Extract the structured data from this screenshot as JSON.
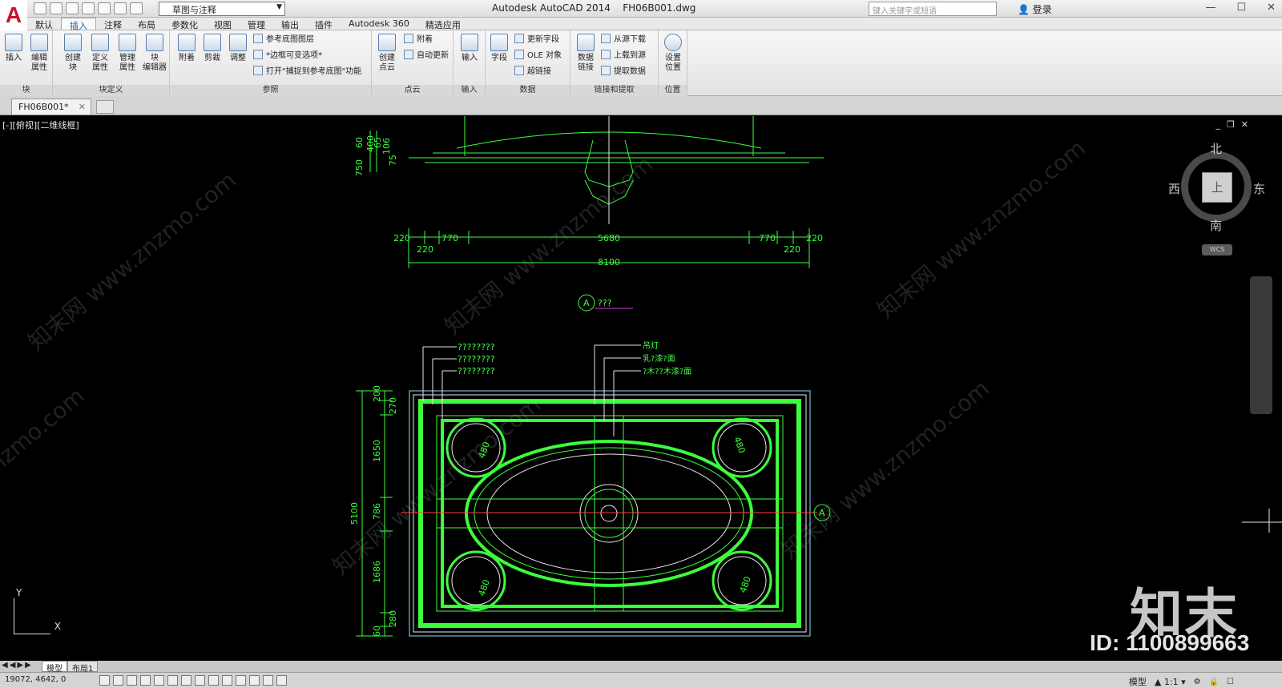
{
  "app": {
    "logo_glyph": "A",
    "title": "Autodesk AutoCAD 2014",
    "document": "FH06B001.dwg",
    "workspace": "草图与注释",
    "search_placeholder": "键入关键字或短语",
    "login": "登录"
  },
  "ribbon_tabs": [
    "默认",
    "插入",
    "注释",
    "布局",
    "参数化",
    "视图",
    "管理",
    "输出",
    "插件",
    "Autodesk 360",
    "精选应用"
  ],
  "active_tab": "插入",
  "panels": {
    "block": {
      "title": "块",
      "buttons": [
        {
          "label": "插入"
        },
        {
          "label": "编辑\n属性"
        }
      ]
    },
    "block_def": {
      "title": "块定义",
      "buttons": [
        {
          "label": "创建\n块"
        },
        {
          "label": "定义\n属性"
        },
        {
          "label": "管理\n属性"
        },
        {
          "label": "块\n编辑器"
        }
      ]
    },
    "reference": {
      "title": "参照",
      "buttons": [
        {
          "label": "附着"
        },
        {
          "label": "剪裁"
        },
        {
          "label": "调整"
        }
      ],
      "small": [
        "参考底图图层",
        "*边框可变选项*",
        "打开\"捕捉到参考底图\"功能"
      ]
    },
    "pointcloud": {
      "title": "点云",
      "buttons": [
        {
          "label": "创建\n点云"
        }
      ],
      "small": [
        "附着",
        "自动更新"
      ]
    },
    "import": {
      "title": "输入",
      "buttons": [
        {
          "label": "输入"
        }
      ]
    },
    "data": {
      "title": "数据",
      "buttons": [
        {
          "label": "字段"
        }
      ],
      "small": [
        "更新字段",
        "OLE 对象",
        "超链接"
      ]
    },
    "linking": {
      "title": "链接和提取",
      "buttons": [
        {
          "label": "数据\n链接"
        }
      ],
      "small": [
        "从源下载",
        "上载到源",
        "提取数据"
      ]
    },
    "location": {
      "title": "位置",
      "buttons": [
        {
          "label": "设置\n位置"
        }
      ]
    }
  },
  "document_tab": "FH06B001*",
  "viewport": {
    "label": "[-][俯视][二维线框]",
    "ctrl_min": "_",
    "ctrl_restore": "❐",
    "ctrl_close": "✕"
  },
  "viewcube": {
    "north": "北",
    "south": "南",
    "east": "东",
    "west": "西",
    "face": "上",
    "wcs": "WCS"
  },
  "drawing": {
    "top_dims_left": [
      "750",
      "400",
      "60",
      "65",
      "106",
      "75"
    ],
    "dim_row1": [
      "220",
      "770",
      "5680",
      "770",
      "220"
    ],
    "dim_row2": [
      "220",
      "220"
    ],
    "dim_total": "8100",
    "section_marker": "A",
    "section_label": "???",
    "left_callouts": [
      "????????",
      "????????",
      "????????"
    ],
    "right_callouts": [
      "吊灯",
      "乳?漆?面",
      "?木??木漆?面"
    ],
    "side_dims": [
      "200",
      "270",
      "1650",
      "786",
      "1686",
      "280",
      "60"
    ],
    "total_height": "5100",
    "circle_dims": [
      "480",
      "480",
      "480",
      "480"
    ],
    "right_marker": "A"
  },
  "ucs": {
    "x": "X",
    "y": "Y"
  },
  "watermark": {
    "brand": "知末",
    "id": "ID: 1100899663",
    "site": "znzmo.com",
    "site_cn": "知末网 www.znzmo.com"
  },
  "layout_tabs": [
    "模型",
    "布局1"
  ],
  "status": {
    "coords": "19072, 4642, 0",
    "model": "模型",
    "scale": "1:1"
  }
}
